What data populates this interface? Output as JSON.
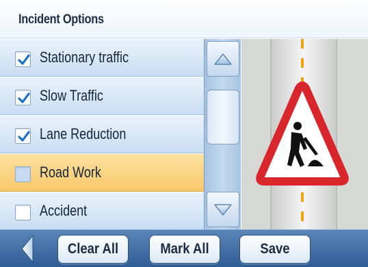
{
  "header": {
    "title": "Incident Options"
  },
  "incidents": [
    {
      "label": "Stationary traffic",
      "checked": true
    },
    {
      "label": "Slow Traffic",
      "checked": true
    },
    {
      "label": "Lane Reduction",
      "checked": true
    },
    {
      "label": "Road Work",
      "checked": false,
      "selected": true
    },
    {
      "label": "Accident",
      "checked": false
    }
  ],
  "scroll": {
    "up_icon": "triangle-up-icon",
    "down_icon": "triangle-down-icon"
  },
  "preview": {
    "icon": "road-work-warning-sign-icon"
  },
  "toolbar": {
    "back_icon": "back-arrow-icon",
    "clear_all_label": "Clear All",
    "mark_all_label": "Mark All",
    "save_label": "Save"
  },
  "colors": {
    "selected_row": "#f8c96b",
    "toolbar": "#2f5d95",
    "checkmark": "#1d6fc9",
    "sign_border": "#d8262c"
  }
}
